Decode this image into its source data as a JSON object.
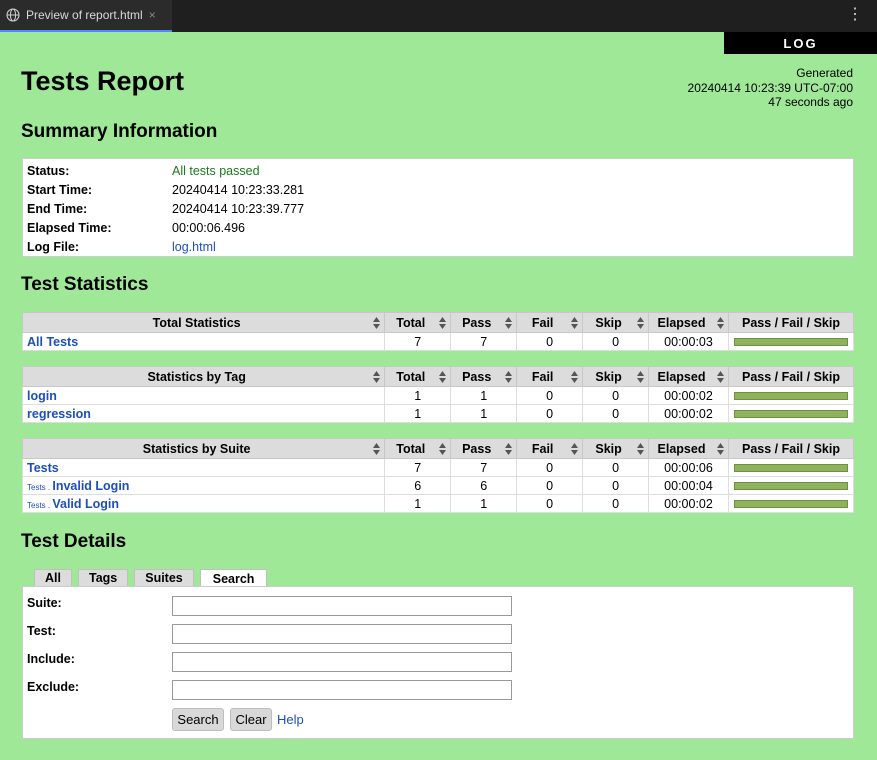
{
  "browser": {
    "tab_title": "Preview of report.html",
    "close_glyph": "×",
    "menu_glyph": "⋮"
  },
  "log_button": "LOG",
  "title": "Tests Report",
  "generated": {
    "label": "Generated",
    "timestamp": "20240414 10:23:39 UTC-07:00",
    "ago": "47 seconds ago"
  },
  "summary": {
    "heading": "Summary Information",
    "status_label": "Status:",
    "status_value": "All tests passed",
    "start_label": "Start Time:",
    "start_value": "20240414 10:23:33.281",
    "end_label": "End Time:",
    "end_value": "20240414 10:23:39.777",
    "elapsed_label": "Elapsed Time:",
    "elapsed_value": "00:00:06.496",
    "log_label": "Log File:",
    "log_value": "log.html"
  },
  "statistics": {
    "heading": "Test Statistics",
    "columns": [
      "Total",
      "Pass",
      "Fail",
      "Skip",
      "Elapsed",
      "Pass / Fail / Skip"
    ],
    "total": {
      "header": "Total Statistics",
      "rows": [
        {
          "name": "All Tests",
          "total": "7",
          "pass": "7",
          "fail": "0",
          "skip": "0",
          "elapsed": "00:00:03",
          "pass_fraction": 1.0
        }
      ]
    },
    "tag": {
      "header": "Statistics by Tag",
      "rows": [
        {
          "name": "login",
          "total": "1",
          "pass": "1",
          "fail": "0",
          "skip": "0",
          "elapsed": "00:00:02",
          "pass_fraction": 1.0
        },
        {
          "name": "regression",
          "total": "1",
          "pass": "1",
          "fail": "0",
          "skip": "0",
          "elapsed": "00:00:02",
          "pass_fraction": 1.0
        }
      ]
    },
    "suite": {
      "header": "Statistics by Suite",
      "rows": [
        {
          "parent": "",
          "name": "Tests",
          "total": "7",
          "pass": "7",
          "fail": "0",
          "skip": "0",
          "elapsed": "00:00:06",
          "pass_fraction": 1.0
        },
        {
          "parent": "Tests . ",
          "name": "Invalid Login",
          "total": "6",
          "pass": "6",
          "fail": "0",
          "skip": "0",
          "elapsed": "00:00:04",
          "pass_fraction": 1.0
        },
        {
          "parent": "Tests . ",
          "name": "Valid Login",
          "total": "1",
          "pass": "1",
          "fail": "0",
          "skip": "0",
          "elapsed": "00:00:02",
          "pass_fraction": 1.0
        }
      ]
    }
  },
  "details": {
    "heading": "Test Details",
    "tabs": [
      "All",
      "Tags",
      "Suites",
      "Search"
    ],
    "active_tab": "Search",
    "fields": {
      "suite_label": "Suite:",
      "test_label": "Test:",
      "include_label": "Include:",
      "exclude_label": "Exclude:"
    },
    "search_button": "Search",
    "clear_button": "Clear",
    "help_link": "Help"
  },
  "colors": {
    "background": "#9ee897",
    "pass_text": "#1c7a1c",
    "link": "#1d4fb8",
    "bar_pass": "#8fb35c"
  }
}
